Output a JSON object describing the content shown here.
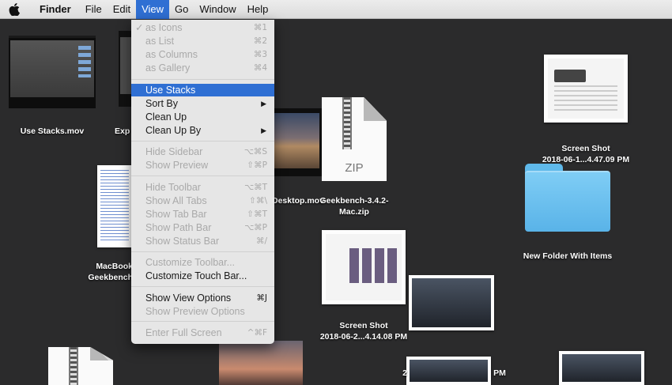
{
  "menubar": {
    "items": [
      {
        "label": "Finder"
      },
      {
        "label": "File"
      },
      {
        "label": "Edit"
      },
      {
        "label": "View"
      },
      {
        "label": "Go"
      },
      {
        "label": "Window"
      },
      {
        "label": "Help"
      }
    ]
  },
  "desktop": {
    "icons": [
      {
        "label": "Use Stacks.mov"
      },
      {
        "label": "Exp"
      },
      {
        "label": "Desktop.mov"
      },
      {
        "label": "Geekbench-3.4.2-\nMac.zip",
        "zip_text": "ZIP"
      },
      {
        "label": "Screen Shot\n2018-06-1...4.47.09 PM"
      },
      {
        "label": "New Folder With Items"
      },
      {
        "label": "MacBook\nGeekbench"
      },
      {
        "label": "Screen Shot\n2018-06-2...4.14.08 PM"
      },
      {
        "label": "2"
      },
      {
        "label": "PM"
      }
    ]
  },
  "view_menu": {
    "items": [
      {
        "label": "as Icons",
        "shortcut": "⌘1",
        "checked": true,
        "enabled": false
      },
      {
        "label": "as List",
        "shortcut": "⌘2",
        "enabled": false
      },
      {
        "label": "as Columns",
        "shortcut": "⌘3",
        "enabled": false
      },
      {
        "label": "as Gallery",
        "shortcut": "⌘4",
        "enabled": false
      },
      {
        "label": "Use Stacks",
        "shortcut": "",
        "highlighted": true
      },
      {
        "label": "Sort By",
        "submenu": true
      },
      {
        "label": "Clean Up",
        "shortcut": ""
      },
      {
        "label": "Clean Up By",
        "submenu": true
      },
      {
        "label": "Hide Sidebar",
        "shortcut": "⌥⌘S",
        "enabled": false
      },
      {
        "label": "Show Preview",
        "shortcut": "⇧⌘P",
        "enabled": false
      },
      {
        "label": "Hide Toolbar",
        "shortcut": "⌥⌘T",
        "enabled": false
      },
      {
        "label": "Show All Tabs",
        "shortcut": "⇧⌘\\",
        "enabled": false
      },
      {
        "label": "Show Tab Bar",
        "shortcut": "⇧⌘T",
        "enabled": false
      },
      {
        "label": "Show Path Bar",
        "shortcut": "⌥⌘P",
        "enabled": false
      },
      {
        "label": "Show Status Bar",
        "shortcut": "⌘/",
        "enabled": false
      },
      {
        "label": "Customize Toolbar...",
        "shortcut": "",
        "enabled": false
      },
      {
        "label": "Customize Touch Bar...",
        "shortcut": ""
      },
      {
        "label": "Show View Options",
        "shortcut": "⌘J"
      },
      {
        "label": "Show Preview Options",
        "shortcut": "",
        "enabled": false
      },
      {
        "label": "Enter Full Screen",
        "shortcut": "^⌘F",
        "enabled": false
      }
    ],
    "check_mark": "✓",
    "submenu_arrow": "▶"
  },
  "colors": {
    "highlight": "#2f6fd3",
    "desktop": "#2b2b2c",
    "folder": "#6cc2f0"
  }
}
